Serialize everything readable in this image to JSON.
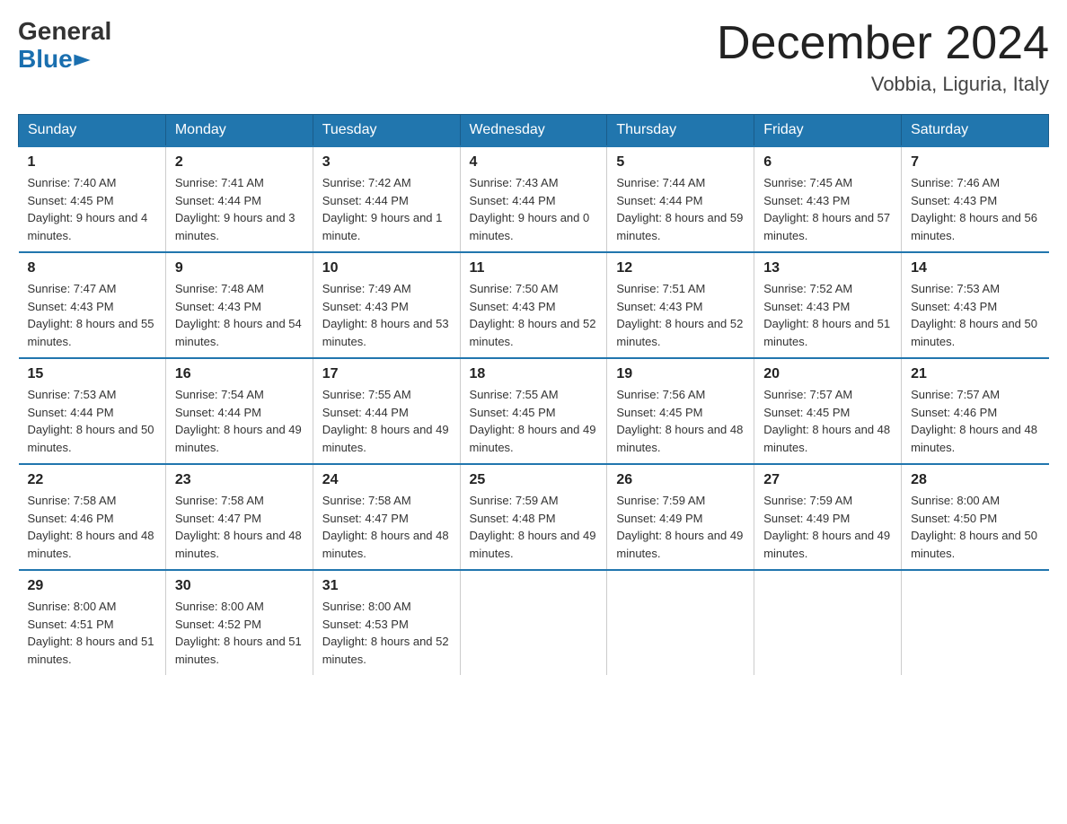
{
  "logo": {
    "general": "General",
    "blue": "Blue"
  },
  "title": "December 2024",
  "location": "Vobbia, Liguria, Italy",
  "days_of_week": [
    "Sunday",
    "Monday",
    "Tuesday",
    "Wednesday",
    "Thursday",
    "Friday",
    "Saturday"
  ],
  "weeks": [
    [
      {
        "day": "1",
        "sunrise": "7:40 AM",
        "sunset": "4:45 PM",
        "daylight": "9 hours and 4 minutes."
      },
      {
        "day": "2",
        "sunrise": "7:41 AM",
        "sunset": "4:44 PM",
        "daylight": "9 hours and 3 minutes."
      },
      {
        "day": "3",
        "sunrise": "7:42 AM",
        "sunset": "4:44 PM",
        "daylight": "9 hours and 1 minute."
      },
      {
        "day": "4",
        "sunrise": "7:43 AM",
        "sunset": "4:44 PM",
        "daylight": "9 hours and 0 minutes."
      },
      {
        "day": "5",
        "sunrise": "7:44 AM",
        "sunset": "4:44 PM",
        "daylight": "8 hours and 59 minutes."
      },
      {
        "day": "6",
        "sunrise": "7:45 AM",
        "sunset": "4:43 PM",
        "daylight": "8 hours and 57 minutes."
      },
      {
        "day": "7",
        "sunrise": "7:46 AM",
        "sunset": "4:43 PM",
        "daylight": "8 hours and 56 minutes."
      }
    ],
    [
      {
        "day": "8",
        "sunrise": "7:47 AM",
        "sunset": "4:43 PM",
        "daylight": "8 hours and 55 minutes."
      },
      {
        "day": "9",
        "sunrise": "7:48 AM",
        "sunset": "4:43 PM",
        "daylight": "8 hours and 54 minutes."
      },
      {
        "day": "10",
        "sunrise": "7:49 AM",
        "sunset": "4:43 PM",
        "daylight": "8 hours and 53 minutes."
      },
      {
        "day": "11",
        "sunrise": "7:50 AM",
        "sunset": "4:43 PM",
        "daylight": "8 hours and 52 minutes."
      },
      {
        "day": "12",
        "sunrise": "7:51 AM",
        "sunset": "4:43 PM",
        "daylight": "8 hours and 52 minutes."
      },
      {
        "day": "13",
        "sunrise": "7:52 AM",
        "sunset": "4:43 PM",
        "daylight": "8 hours and 51 minutes."
      },
      {
        "day": "14",
        "sunrise": "7:53 AM",
        "sunset": "4:43 PM",
        "daylight": "8 hours and 50 minutes."
      }
    ],
    [
      {
        "day": "15",
        "sunrise": "7:53 AM",
        "sunset": "4:44 PM",
        "daylight": "8 hours and 50 minutes."
      },
      {
        "day": "16",
        "sunrise": "7:54 AM",
        "sunset": "4:44 PM",
        "daylight": "8 hours and 49 minutes."
      },
      {
        "day": "17",
        "sunrise": "7:55 AM",
        "sunset": "4:44 PM",
        "daylight": "8 hours and 49 minutes."
      },
      {
        "day": "18",
        "sunrise": "7:55 AM",
        "sunset": "4:45 PM",
        "daylight": "8 hours and 49 minutes."
      },
      {
        "day": "19",
        "sunrise": "7:56 AM",
        "sunset": "4:45 PM",
        "daylight": "8 hours and 48 minutes."
      },
      {
        "day": "20",
        "sunrise": "7:57 AM",
        "sunset": "4:45 PM",
        "daylight": "8 hours and 48 minutes."
      },
      {
        "day": "21",
        "sunrise": "7:57 AM",
        "sunset": "4:46 PM",
        "daylight": "8 hours and 48 minutes."
      }
    ],
    [
      {
        "day": "22",
        "sunrise": "7:58 AM",
        "sunset": "4:46 PM",
        "daylight": "8 hours and 48 minutes."
      },
      {
        "day": "23",
        "sunrise": "7:58 AM",
        "sunset": "4:47 PM",
        "daylight": "8 hours and 48 minutes."
      },
      {
        "day": "24",
        "sunrise": "7:58 AM",
        "sunset": "4:47 PM",
        "daylight": "8 hours and 48 minutes."
      },
      {
        "day": "25",
        "sunrise": "7:59 AM",
        "sunset": "4:48 PM",
        "daylight": "8 hours and 49 minutes."
      },
      {
        "day": "26",
        "sunrise": "7:59 AM",
        "sunset": "4:49 PM",
        "daylight": "8 hours and 49 minutes."
      },
      {
        "day": "27",
        "sunrise": "7:59 AM",
        "sunset": "4:49 PM",
        "daylight": "8 hours and 49 minutes."
      },
      {
        "day": "28",
        "sunrise": "8:00 AM",
        "sunset": "4:50 PM",
        "daylight": "8 hours and 50 minutes."
      }
    ],
    [
      {
        "day": "29",
        "sunrise": "8:00 AM",
        "sunset": "4:51 PM",
        "daylight": "8 hours and 51 minutes."
      },
      {
        "day": "30",
        "sunrise": "8:00 AM",
        "sunset": "4:52 PM",
        "daylight": "8 hours and 51 minutes."
      },
      {
        "day": "31",
        "sunrise": "8:00 AM",
        "sunset": "4:53 PM",
        "daylight": "8 hours and 52 minutes."
      },
      null,
      null,
      null,
      null
    ]
  ],
  "labels": {
    "sunrise": "Sunrise:",
    "sunset": "Sunset:",
    "daylight": "Daylight:"
  }
}
